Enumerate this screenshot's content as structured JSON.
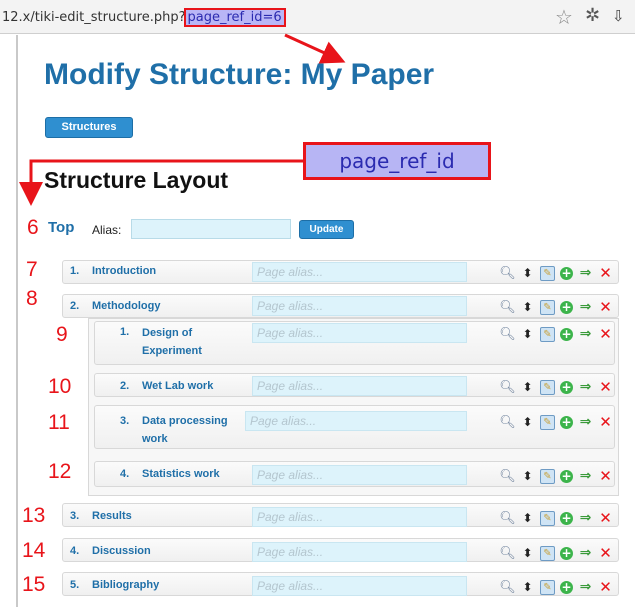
{
  "browser": {
    "url_prefix": "12.x/tiki-edit_structure.php?",
    "url_param": "page_ref_id=6"
  },
  "page": {
    "title": "Modify Structure: My Paper",
    "structures_button": "Structures",
    "section_title": "Structure Layout"
  },
  "callout": {
    "label": "page_ref_id"
  },
  "root": {
    "number": "6",
    "label": "Top",
    "alias_label": "Alias:",
    "alias_value": "",
    "update_button": "Update"
  },
  "alias_placeholder": "Page alias...",
  "items": [
    {
      "annotation": "7",
      "num": "1.",
      "name": "Introduction"
    },
    {
      "annotation": "8",
      "num": "2.",
      "name": "Methodology"
    },
    {
      "annotation": "9",
      "num": "1.",
      "name": "Design of Experiment"
    },
    {
      "annotation": "10",
      "num": "2.",
      "name": "Wet Lab work"
    },
    {
      "annotation": "11",
      "num": "3.",
      "name": "Data processing work"
    },
    {
      "annotation": "12",
      "num": "4.",
      "name": "Statistics work"
    },
    {
      "annotation": "13",
      "num": "3.",
      "name": "Results"
    },
    {
      "annotation": "14",
      "num": "4.",
      "name": "Discussion"
    },
    {
      "annotation": "15",
      "num": "5.",
      "name": "Bibliography"
    }
  ],
  "icons": [
    "search-icon",
    "move-icon",
    "edit-icon",
    "add-icon",
    "promote-arrow-icon",
    "delete-icon"
  ],
  "colors": {
    "link_blue": "#1f6fa8",
    "annotation_red": "#e8141a",
    "callout_fill": "#b7b5f4",
    "button_blue": "#2f8fd0"
  }
}
